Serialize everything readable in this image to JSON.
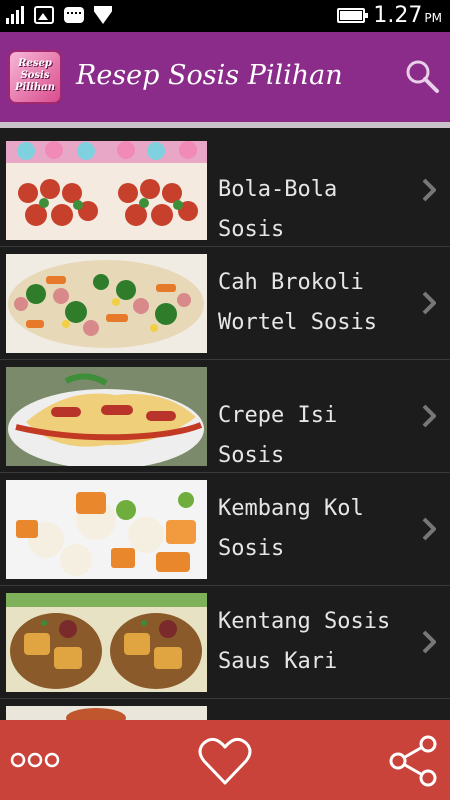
{
  "status_bar": {
    "time": "1.27",
    "ampm": "PM"
  },
  "app_bar": {
    "title": "Resep Sosis Pilihan",
    "logo_text": "Resep Sosis Pilihan",
    "search_icon": "search-icon"
  },
  "list": {
    "items": [
      {
        "label": "Bola-Bola Sosis",
        "thumb": "meatball-skewers"
      },
      {
        "label": "Cah Brokoli\nWortel Sosis",
        "thumb": "broccoli-carrot-sausage"
      },
      {
        "label": "Crepe Isi Sosis",
        "thumb": "crepe-sausage"
      },
      {
        "label": "Kembang Kol\nSosis",
        "thumb": "cauliflower-sausage"
      },
      {
        "label": "Kentang Sosis\nSaus Kari",
        "thumb": "potato-curry-sausage"
      },
      {
        "label": "",
        "thumb": "partial-dish"
      }
    ]
  },
  "bottom_bar": {
    "more_icon": "more-icon",
    "favorite_icon": "heart-icon",
    "share_icon": "share-icon"
  },
  "colors": {
    "app_bar": "#8b2b8a",
    "bottom_bar": "#c9433a",
    "list_bg": "#1c1c1c",
    "text": "#e6e6e6"
  }
}
